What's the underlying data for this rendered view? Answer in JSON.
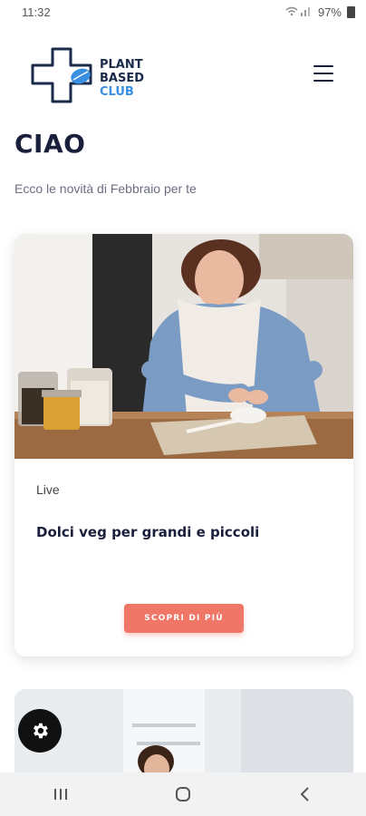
{
  "status_bar": {
    "time": "11:32",
    "battery": "97%"
  },
  "header": {
    "logo_line1": "PLANT",
    "logo_line2": "BASED",
    "logo_line3": "CLUB"
  },
  "greeting": {
    "title": "CIAO",
    "subtitle": "Ecco le novità di Febbraio per te"
  },
  "card": {
    "tag": "Live",
    "title": "Dolci veg per grandi e piccoli",
    "button_label": "SCOPRI DI PIÙ"
  },
  "colors": {
    "primary": "#1a1f3c",
    "accent": "#f07768",
    "logo_blue": "#3a8fe0"
  },
  "icons": {
    "menu": "hamburger-icon",
    "fab": "gear-icon",
    "nav_recent": "recent-apps-icon",
    "nav_home": "home-icon",
    "nav_back": "back-icon"
  }
}
